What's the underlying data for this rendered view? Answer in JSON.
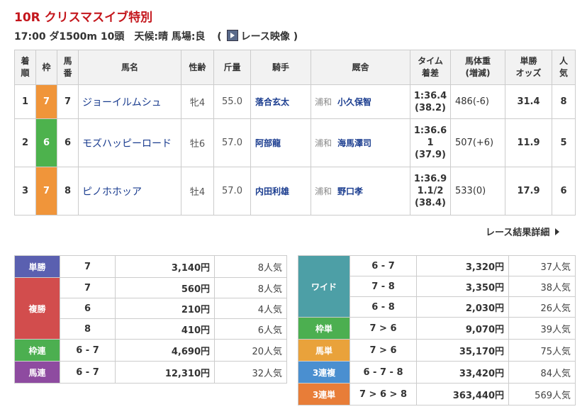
{
  "race": {
    "title": "10R クリスマスイブ特別",
    "info_main": "17:00 ダ1500m 10頭　天候:晴 馬場:良",
    "video_open": "(",
    "video_label": "レース映像",
    "video_close": ")"
  },
  "headers": {
    "rank": [
      "着",
      "順"
    ],
    "waku": "枠",
    "num": [
      "馬",
      "番"
    ],
    "horse": "馬名",
    "sex_age": "性齢",
    "kinryo": "斤量",
    "jockey": "騎手",
    "trainer": "厩舎",
    "time": [
      "タイム",
      "着差"
    ],
    "weight": [
      "馬体重",
      "(増減)"
    ],
    "odds": [
      "単勝",
      "オッズ"
    ],
    "pop": [
      "人",
      "気"
    ]
  },
  "colors": {
    "waku7": "#f0953a",
    "waku6": "#4db24d",
    "tansho": "#5a60b0",
    "fukusho": "#d24d4d",
    "wakuren": "#4caf50",
    "umaren": "#8e4ba0",
    "wide": "#4d9fa6",
    "wakutan": "#4caf50",
    "umatan": "#e9a23b",
    "sanrenpuku": "#4a8fd0",
    "sanrentan": "#e87d38"
  },
  "results": [
    {
      "rank": "1",
      "waku": "7",
      "num": "7",
      "horse": "ジョーイルムシュ",
      "sex_age": "牝4",
      "kinryo": "55.0",
      "jockey": "落合玄太",
      "region": "浦和",
      "trainer": "小久保智",
      "time": [
        "1:36.4",
        "(38.2)"
      ],
      "weight": "486(-6)",
      "odds": "31.4",
      "pop": "8"
    },
    {
      "rank": "2",
      "waku": "6",
      "num": "6",
      "horse": "モズハッピーロード",
      "sex_age": "牡6",
      "kinryo": "57.0",
      "jockey": "阿部龍",
      "region": "浦和",
      "trainer": "海馬澤司",
      "time": [
        "1:36.6",
        "1",
        "(37.9)"
      ],
      "weight": "507(+6)",
      "odds": "11.9",
      "pop": "5"
    },
    {
      "rank": "3",
      "waku": "7",
      "num": "8",
      "horse": "ピノホホッア",
      "sex_age": "牡4",
      "kinryo": "57.0",
      "jockey": "内田利雄",
      "region": "浦和",
      "trainer": "野口孝",
      "time": [
        "1:36.9",
        "1.1/2",
        "(38.4)"
      ],
      "weight": "533(0)",
      "odds": "17.9",
      "pop": "6"
    }
  ],
  "detail_link": "レース結果詳細",
  "payouts_left": {
    "tansho": {
      "label": "単勝",
      "rows": [
        {
          "combo": "7",
          "amount": "3,140円",
          "pop": "8人気"
        }
      ]
    },
    "fukusho": {
      "label": "複勝",
      "rows": [
        {
          "combo": "7",
          "amount": "560円",
          "pop": "8人気"
        },
        {
          "combo": "6",
          "amount": "210円",
          "pop": "4人気"
        },
        {
          "combo": "8",
          "amount": "410円",
          "pop": "6人気"
        }
      ]
    },
    "wakuren": {
      "label": "枠連",
      "rows": [
        {
          "combo": "6 - 7",
          "amount": "4,690円",
          "pop": "20人気"
        }
      ]
    },
    "umaren": {
      "label": "馬連",
      "rows": [
        {
          "combo": "6 - 7",
          "amount": "12,310円",
          "pop": "32人気"
        }
      ]
    }
  },
  "payouts_right": {
    "wide": {
      "label": "ワイド",
      "rows": [
        {
          "combo": "6 - 7",
          "amount": "3,320円",
          "pop": "37人気"
        },
        {
          "combo": "7 - 8",
          "amount": "3,350円",
          "pop": "38人気"
        },
        {
          "combo": "6 - 8",
          "amount": "2,030円",
          "pop": "26人気"
        }
      ]
    },
    "wakutan": {
      "label": "枠単",
      "rows": [
        {
          "combo": "7 > 6",
          "amount": "9,070円",
          "pop": "39人気"
        }
      ]
    },
    "umatan": {
      "label": "馬単",
      "rows": [
        {
          "combo": "7 > 6",
          "amount": "35,170円",
          "pop": "75人気"
        }
      ]
    },
    "sanrenpuku": {
      "label": "3連複",
      "rows": [
        {
          "combo": "6 - 7 - 8",
          "amount": "33,420円",
          "pop": "84人気"
        }
      ]
    },
    "sanrentan": {
      "label": "3連単",
      "rows": [
        {
          "combo": "7 > 6 > 8",
          "amount": "363,440円",
          "pop": "569人気"
        }
      ]
    }
  }
}
